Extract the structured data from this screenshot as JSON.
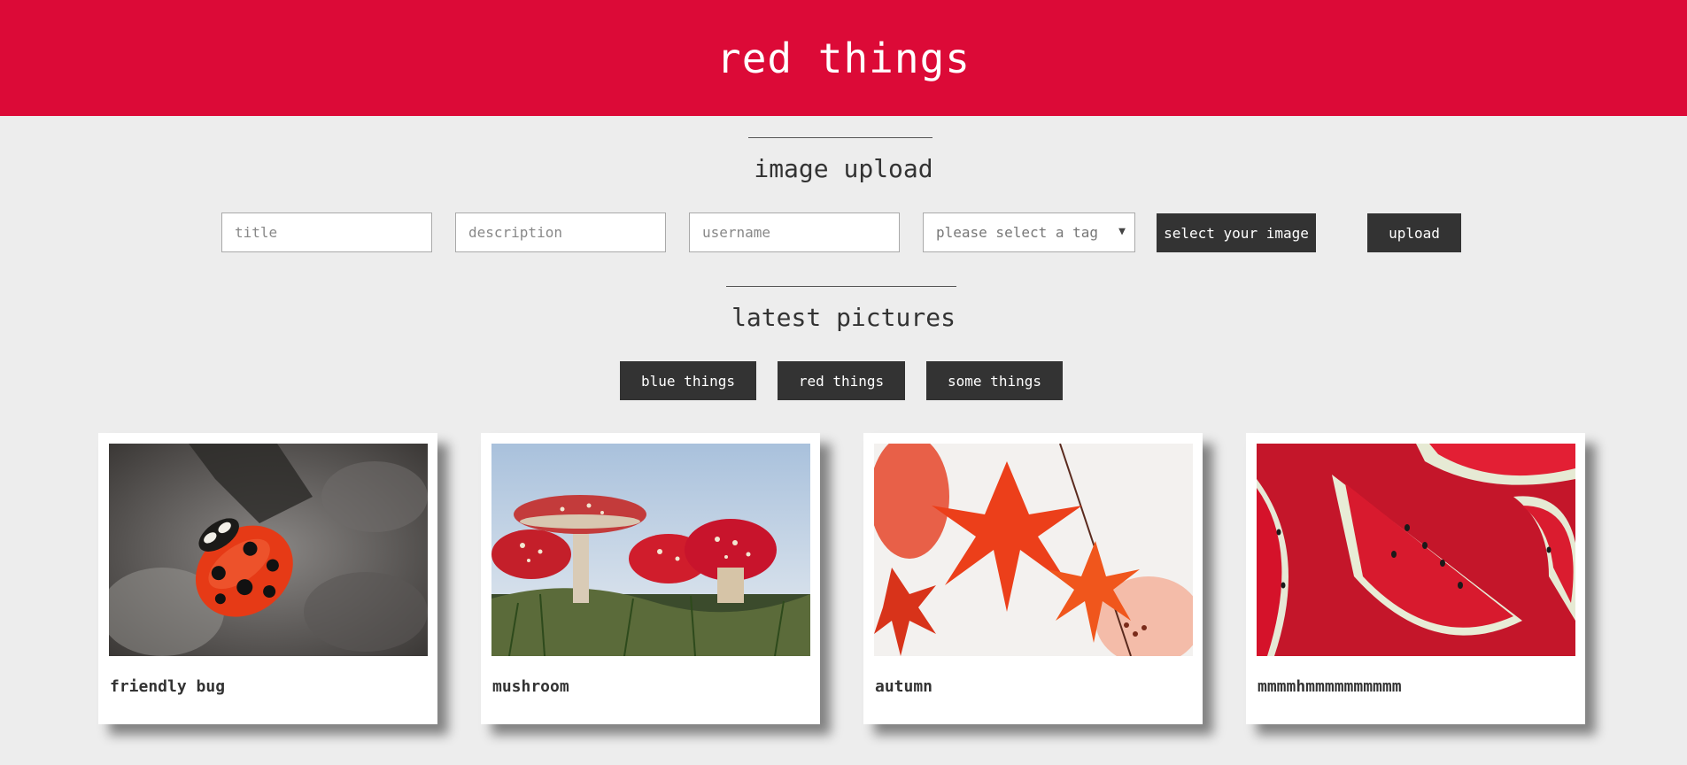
{
  "header": {
    "title": "red things"
  },
  "upload": {
    "heading": "image upload",
    "title_placeholder": "title",
    "description_placeholder": "description",
    "username_placeholder": "username",
    "tag_select": {
      "selected": "please select a tag"
    },
    "select_image_label": "select your image",
    "upload_label": "upload"
  },
  "latest": {
    "heading": "latest pictures",
    "filters": [
      "blue things",
      "red things",
      "some things"
    ]
  },
  "cards": [
    {
      "caption": "friendly bug",
      "image": "ladybug-photo"
    },
    {
      "caption": "mushroom",
      "image": "mushroom-photo"
    },
    {
      "caption": "autumn",
      "image": "red-leaves-photo"
    },
    {
      "caption": "mmmmhmmmmmmmmmm",
      "image": "watermelon-photo"
    }
  ],
  "colors": {
    "header_bg": "#dc0a37",
    "page_bg": "#ededed",
    "button_bg": "#333333"
  }
}
